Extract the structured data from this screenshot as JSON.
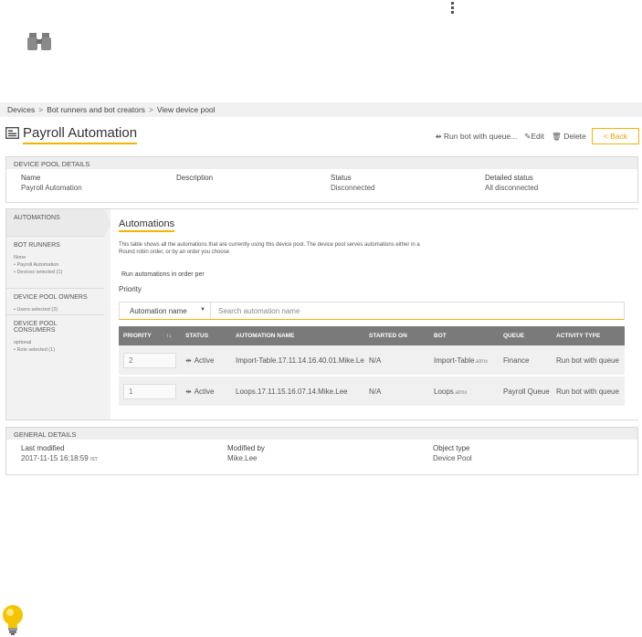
{
  "breadcrumb": [
    "Devices",
    "Bot runners and bot creators",
    "View device pool"
  ],
  "breadcrumb_separator": ">",
  "page_title": "Payroll Automation",
  "actions": {
    "run_label": "Run bot with queue...",
    "edit_label": "Edit",
    "delete_label": "Delete",
    "back_label": "< Back"
  },
  "device_pool_details": {
    "heading": "DEVICE POOL DETAILS",
    "fields": [
      {
        "label": "Name",
        "value": "Payroll Automation"
      },
      {
        "label": "Description",
        "value": ""
      },
      {
        "label": "Status",
        "value": "Disconnected"
      },
      {
        "label": "Detailed status",
        "value": "All disconnected"
      }
    ]
  },
  "sidebar": {
    "automations": "AUTOMATIONS",
    "bot_runners": {
      "heading": "BOT RUNNERS",
      "lines": [
        "None",
        "• Payroll Automation",
        "• Devices selected (1)"
      ]
    },
    "owners": {
      "heading": "DEVICE POOL OWNERS",
      "lines": [
        "• Users selected (2)"
      ]
    },
    "consumers": {
      "heading": "DEVICE POOL CONSUMERS",
      "lines": [
        "optional",
        "• Role selected (1)"
      ]
    }
  },
  "automations": {
    "heading": "Automations",
    "description": "This table shows all the automations that are currently using this device pool. The device pool serves automations either in a Round robin order, or by an order you choose",
    "run_order_label": "Run automations in order per",
    "priority_label": "Priority",
    "filter_select": "Automation name",
    "search_placeholder": "Search automation name",
    "columns": [
      "PRIORITY",
      "STATUS",
      "AUTOMATION NAME",
      "STARTED ON",
      "BOT",
      "QUEUE",
      "ACTIVITY TYPE"
    ],
    "rows": [
      {
        "priority": "2",
        "status": "Active",
        "name": "Import-Table.17.11.14.16.40.01.Mike.Lee",
        "started": "N/A",
        "bot": "Import-Table",
        "bot_ext": ".atmx",
        "queue": "Finance",
        "activity": "Run bot with queue"
      },
      {
        "priority": "1",
        "status": "Active",
        "name": "Loops.17.11.15.16.07.14.Mike.Lee",
        "started": "N/A",
        "bot": "Loops",
        "bot_ext": ".atmx",
        "queue": "Payroll Queue",
        "activity": "Run bot with queue"
      }
    ]
  },
  "general_details": {
    "heading": "GENERAL DETAILS",
    "fields": [
      {
        "label": "Last modified",
        "value": "2017-11-15 16:18:59",
        "suffix": "IST"
      },
      {
        "label": "Modified by",
        "value": "Mike.Lee"
      },
      {
        "label": "Object type",
        "value": "Device Pool"
      }
    ]
  },
  "colors": {
    "accent": "#f5b400",
    "table_header": "#7a7a7a",
    "panel_header": "#eeeeee"
  },
  "icons": [
    "kebab-menu-icon",
    "binoculars-icon",
    "device-pool-icon",
    "run-arrow-icon",
    "pencil-icon",
    "trash-icon",
    "sort-icon",
    "lightbulb-icon"
  ]
}
